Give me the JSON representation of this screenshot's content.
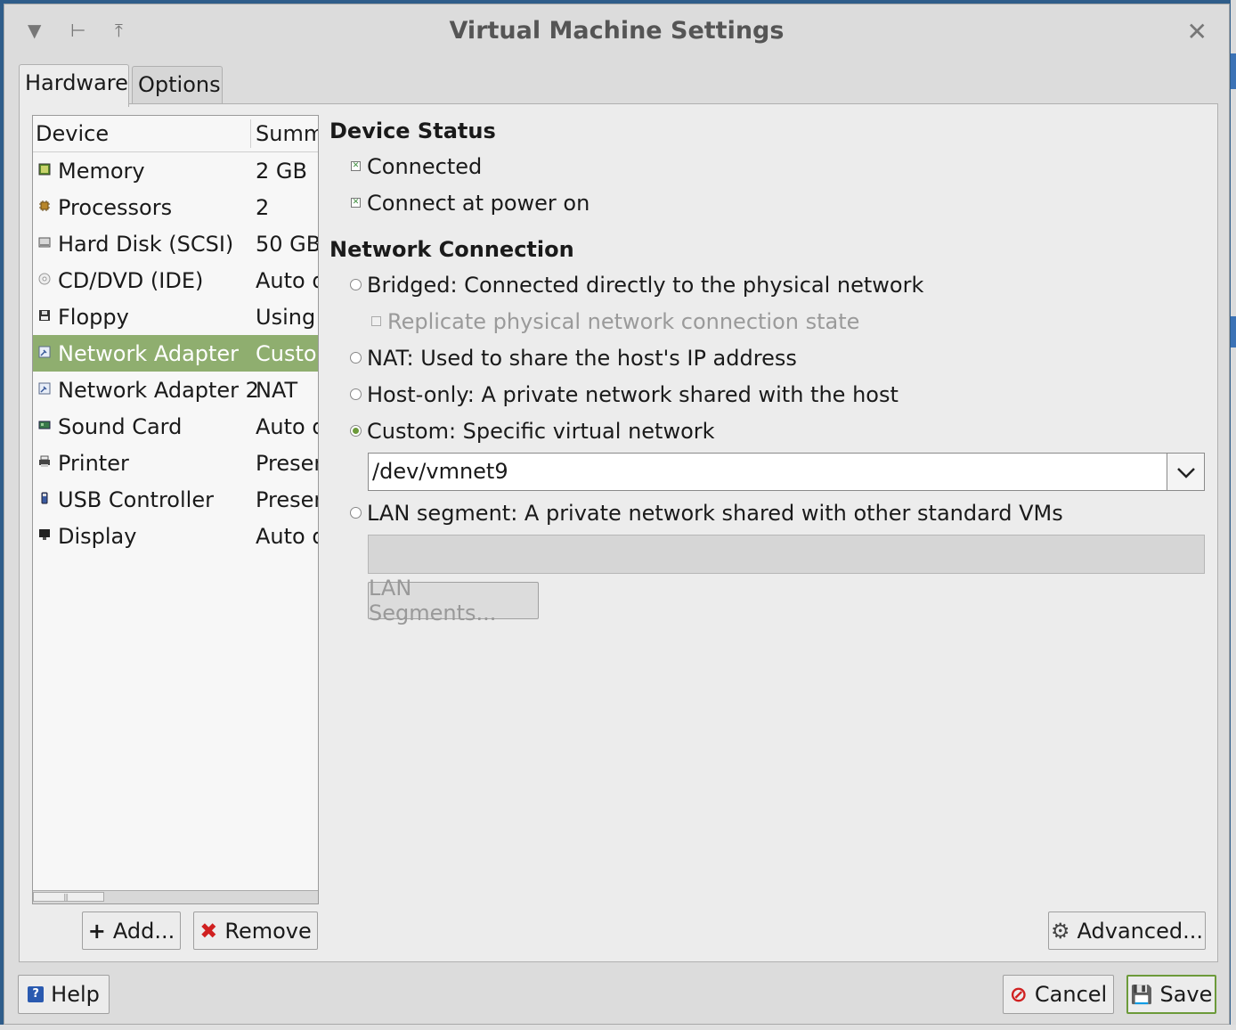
{
  "window": {
    "title": "Virtual Machine Settings"
  },
  "tabs": [
    {
      "label": "Hardware"
    },
    {
      "label": "Options"
    }
  ],
  "device_list": {
    "headers": {
      "device": "Device",
      "summary": "Summ"
    },
    "rows": [
      {
        "name": "Memory",
        "summary": "2 GB",
        "icon": "memory-icon"
      },
      {
        "name": "Processors",
        "summary": "2",
        "icon": "processor-icon"
      },
      {
        "name": "Hard Disk (SCSI)",
        "summary": "50 GB",
        "icon": "hard-disk-icon"
      },
      {
        "name": "CD/DVD (IDE)",
        "summary": "Auto d",
        "icon": "cd-dvd-icon"
      },
      {
        "name": "Floppy",
        "summary": "Using",
        "icon": "floppy-icon"
      },
      {
        "name": "Network Adapter",
        "summary": "Custom",
        "icon": "network-adapter-icon",
        "selected": true
      },
      {
        "name": "Network Adapter 2",
        "summary": "NAT",
        "icon": "network-adapter-icon"
      },
      {
        "name": "Sound Card",
        "summary": "Auto d",
        "icon": "sound-card-icon"
      },
      {
        "name": "Printer",
        "summary": "Presen",
        "icon": "printer-icon"
      },
      {
        "name": "USB Controller",
        "summary": "Presen",
        "icon": "usb-icon"
      },
      {
        "name": "Display",
        "summary": "Auto d",
        "icon": "display-icon"
      }
    ]
  },
  "buttons": {
    "add": "Add...",
    "remove": "Remove",
    "advanced": "Advanced...",
    "help": "Help",
    "cancel": "Cancel",
    "save": "Save",
    "lan_segments": "LAN Segments..."
  },
  "device_status": {
    "heading": "Device Status",
    "connected": "Connected",
    "connect_at_power_on": "Connect at power on"
  },
  "network_connection": {
    "heading": "Network Connection",
    "bridged": "Bridged: Connected directly to the physical network",
    "replicate": "Replicate physical network connection state",
    "nat": "NAT: Used to share the host's IP address",
    "host_only": "Host-only: A private network shared with the host",
    "custom": "Custom: Specific virtual network",
    "custom_value": "/dev/vmnet9",
    "lan_segment": "LAN segment: A private network shared with other standard VMs",
    "selected": "custom"
  },
  "colors": {
    "selection": "#8fae6f",
    "radio_on": "#6c9a3a"
  }
}
